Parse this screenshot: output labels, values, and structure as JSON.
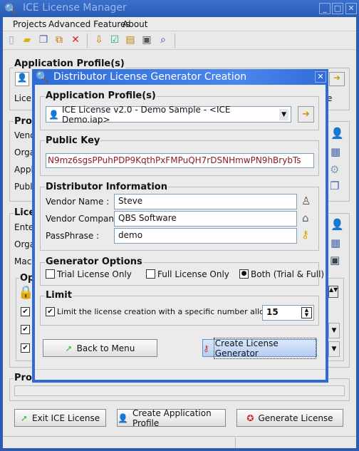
{
  "window": {
    "title": "ICE License Manager",
    "minimize": "_",
    "maximize": "□",
    "close": "✕"
  },
  "menu": [
    "Projects",
    "Advanced Features",
    "About"
  ],
  "toolbar_icons": [
    "new-icon",
    "open-folder-icon",
    "copy-icon",
    "import-icon",
    "delete-icon",
    "download-icon",
    "checklist-icon",
    "package-icon",
    "computer-icon",
    "search-icon"
  ],
  "background": {
    "app_profile_title": "Application Profile(s)",
    "app_profile_label": "Licen",
    "app_profile_trailing": "e",
    "profile_title": "Prof",
    "profile_labels": [
      "Vendo",
      "Orga",
      "Appli",
      "Publi"
    ],
    "license_title": "Lice",
    "license_labels": [
      "Enter",
      "Orga",
      "Mach"
    ],
    "options_title": "Op",
    "progress_title": "Prog",
    "buttons": {
      "exit": "Exit ICE License",
      "create_profile": "Create Application Profile",
      "generate": "Generate License"
    }
  },
  "dialog": {
    "title": "Distributor License Generator Creation",
    "close": "✕",
    "app_profile": {
      "title": "Application Profile(s)",
      "selected": "ICE License v2.0 - Demo Sample - <ICE Demo.iap>"
    },
    "public_key": {
      "title": "Public Key",
      "value": "N9mz6sgsPPuhPDP9KqthPxFMPuQH7rDSNHmwPN9hBrybTs"
    },
    "distributor": {
      "title": "Distributor Information",
      "vendor_name_label": "Vendor Name  :",
      "vendor_name": "Steve",
      "vendor_company_label": "Vendor Company :",
      "vendor_company": "QBS Software",
      "passphrase_label": "PassPhrase :",
      "passphrase": "demo"
    },
    "generator": {
      "title": "Generator Options",
      "options": [
        {
          "label": "Trial License Only",
          "checked": false
        },
        {
          "label": "Full License Only",
          "checked": false
        },
        {
          "label": "Both (Trial & Full)",
          "checked": true
        }
      ]
    },
    "limit": {
      "title": "Limit",
      "label": "Limit the license creation with a specific number allowed :",
      "checked": true,
      "value": "15"
    },
    "back_button": "Back to Menu",
    "create_button": "Create License Generator"
  },
  "colors": {
    "titlebar": "#2a5cb4",
    "dialog_border": "#2e6bd8",
    "public_key_text": "#8b1a2b"
  }
}
